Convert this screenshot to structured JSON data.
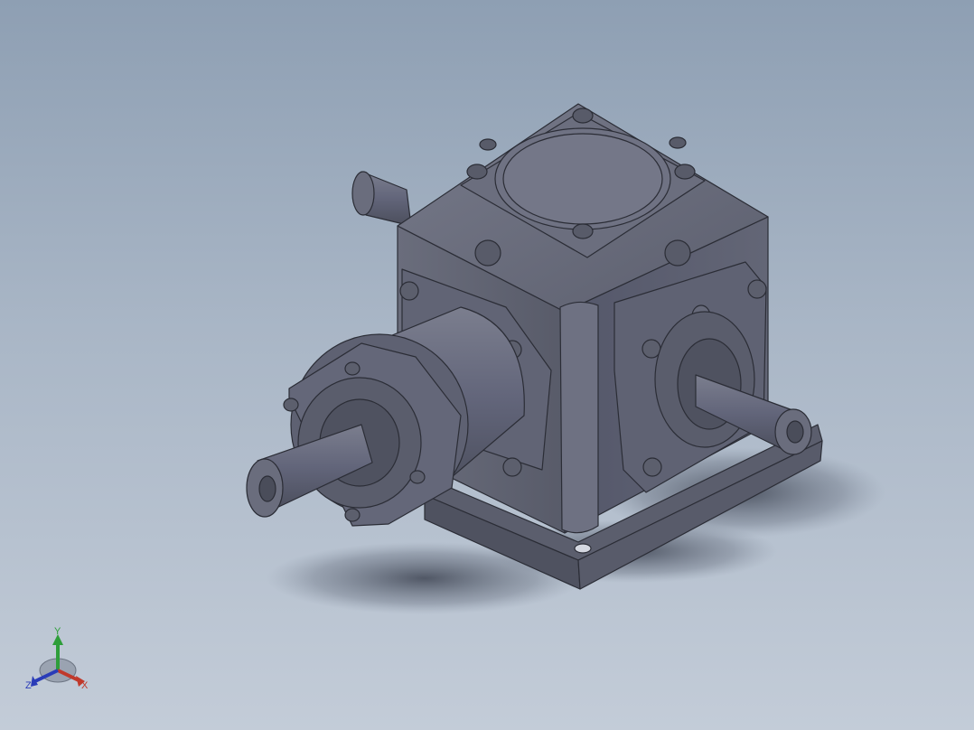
{
  "viewport": {
    "background_top": "#8e9fb3",
    "background_bottom": "#c3ccd8"
  },
  "model": {
    "icon": "gearbox-3d-model",
    "body_color": "#5f6272",
    "edge_color": "#2b2d36",
    "highlight_color": "#9a9dad",
    "shadow_color": "#4a4f5c"
  },
  "triad": {
    "x_label": "X",
    "y_label": "Y",
    "z_label": "Z",
    "x_color": "#c0392b",
    "y_color": "#2e9e3a",
    "z_color": "#2a3cb8"
  }
}
